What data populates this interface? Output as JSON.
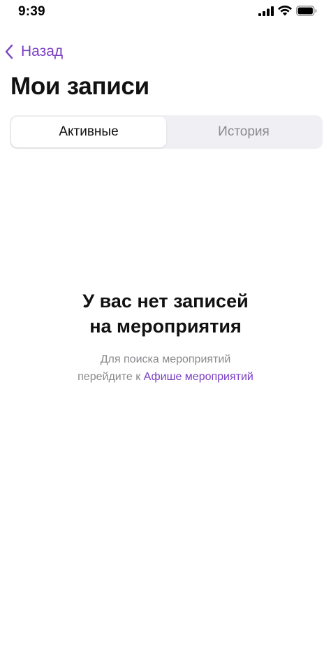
{
  "status_bar": {
    "time": "9:39"
  },
  "nav": {
    "back_label": "Назад"
  },
  "page": {
    "title": "Мои записи"
  },
  "tabs": [
    {
      "label": "Активные",
      "selected": true
    },
    {
      "label": "История",
      "selected": false
    }
  ],
  "empty_state": {
    "title_line1": "У вас нет записей",
    "title_line2": "на мероприятия",
    "subtitle_line1": "Для поиска мероприятий",
    "subtitle_prefix": "перейдите к ",
    "subtitle_link": "Афише мероприятий"
  },
  "colors": {
    "accent": "#7b3fc4",
    "text_primary": "#111111",
    "text_secondary": "#8a8a8e",
    "segment_bg": "#f0f0f4"
  },
  "icons": {
    "back": "chevron-left-icon",
    "signal": "cellular-signal-icon",
    "wifi": "wifi-icon",
    "battery": "battery-icon"
  }
}
